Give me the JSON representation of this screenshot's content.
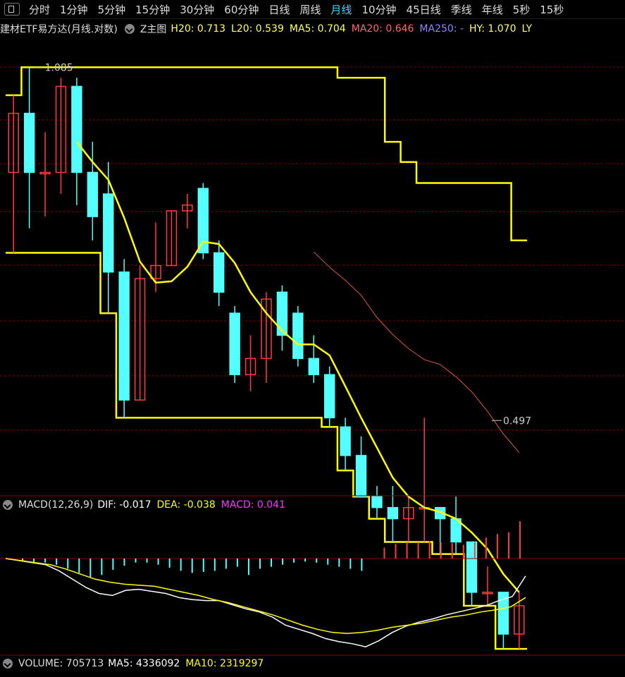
{
  "tabs": [
    "分时",
    "1分钟",
    "5分钟",
    "15分钟",
    "30分钟",
    "60分钟",
    "日线",
    "周线",
    "月线",
    "10分钟",
    "45日线",
    "季线",
    "年线",
    "5秒",
    "15秒"
  ],
  "active_tab": "月线",
  "main_info": {
    "title": "建材ETF易方达(月线.对数)",
    "indicator": "Z主图",
    "items": [
      {
        "text": "H20: 0.713",
        "color": "#ffff66"
      },
      {
        "text": "L20: 0.539",
        "color": "#ffff66"
      },
      {
        "text": "MA5: 0.704",
        "color": "#ffff66"
      },
      {
        "text": "MA20: 0.646",
        "color": "#ff6666"
      },
      {
        "text": "MA250: -",
        "color": "#8888ff"
      },
      {
        "text": "HY: 1.070",
        "color": "#ffff66"
      },
      {
        "text": "LY",
        "color": "#ffff66"
      }
    ]
  },
  "macd_info": {
    "title": "MACD(12,26,9)",
    "items": [
      {
        "text": "DIF: -0.017",
        "color": "#ffffff"
      },
      {
        "text": "DEA: -0.038",
        "color": "#ffff00"
      },
      {
        "text": "MACD: 0.041",
        "color": "#ff33ff"
      }
    ]
  },
  "volume_info": {
    "title": "VOLUME: 705713",
    "items": [
      {
        "text": "MA5: 4336092",
        "color": "#ffffff"
      },
      {
        "text": "MA10: 2319297",
        "color": "#ffff00"
      }
    ]
  },
  "colors": {
    "up": "#ff3b3b",
    "down": "#54ffff",
    "yellow": "#ffff00",
    "ma20": "#d9534f",
    "grid": "#8b0000",
    "dif": "#ffffff",
    "dea": "#ffff00"
  },
  "chart_data": [
    {
      "type": "candlestick",
      "scale": "log",
      "ylim": [
        0.45,
        1.15
      ],
      "annotations": [
        {
          "text": "1.085",
          "value": 1.085,
          "index": 1
        },
        {
          "text": "0.497",
          "value": 0.497,
          "index": 30
        }
      ],
      "candles": [
        {
          "o": 0.86,
          "h": 1.02,
          "l": 0.72,
          "c": 0.98
        },
        {
          "o": 0.98,
          "h": 1.085,
          "l": 0.76,
          "c": 0.86
        },
        {
          "o": 0.86,
          "h": 0.94,
          "l": 0.78,
          "c": 0.86
        },
        {
          "o": 0.86,
          "h": 1.06,
          "l": 0.82,
          "c": 1.04
        },
        {
          "o": 1.04,
          "h": 1.06,
          "l": 0.8,
          "c": 0.86
        },
        {
          "o": 0.86,
          "h": 0.92,
          "l": 0.74,
          "c": 0.78
        },
        {
          "o": 0.82,
          "h": 0.88,
          "l": 0.63,
          "c": 0.69
        },
        {
          "o": 0.69,
          "h": 0.71,
          "l": 0.5,
          "c": 0.52
        },
        {
          "o": 0.52,
          "h": 0.7,
          "l": 0.52,
          "c": 0.68
        },
        {
          "o": 0.68,
          "h": 0.77,
          "l": 0.66,
          "c": 0.7
        },
        {
          "o": 0.7,
          "h": 0.79,
          "l": 0.7,
          "c": 0.79
        },
        {
          "o": 0.79,
          "h": 0.82,
          "l": 0.76,
          "c": 0.8
        },
        {
          "o": 0.83,
          "h": 0.84,
          "l": 0.71,
          "c": 0.72
        },
        {
          "o": 0.72,
          "h": 0.74,
          "l": 0.64,
          "c": 0.66
        },
        {
          "o": 0.63,
          "h": 0.64,
          "l": 0.54,
          "c": 0.55
        },
        {
          "o": 0.55,
          "h": 0.6,
          "l": 0.53,
          "c": 0.57
        },
        {
          "o": 0.57,
          "h": 0.66,
          "l": 0.54,
          "c": 0.65
        },
        {
          "o": 0.66,
          "h": 0.67,
          "l": 0.58,
          "c": 0.6
        },
        {
          "o": 0.63,
          "h": 0.64,
          "l": 0.56,
          "c": 0.57
        },
        {
          "o": 0.57,
          "h": 0.6,
          "l": 0.54,
          "c": 0.55
        },
        {
          "o": 0.55,
          "h": 0.56,
          "l": 0.49,
          "c": 0.5
        },
        {
          "o": 0.49,
          "h": 0.5,
          "l": 0.445,
          "c": 0.46
        },
        {
          "o": 0.46,
          "h": 0.48,
          "l": 0.42,
          "c": 0.42
        },
        {
          "o": 0.42,
          "h": 0.43,
          "l": 0.4,
          "c": 0.41
        },
        {
          "o": 0.41,
          "h": 0.43,
          "l": 0.38,
          "c": 0.4
        },
        {
          "o": 0.4,
          "h": 0.42,
          "l": 0.38,
          "c": 0.41
        },
        {
          "o": 0.41,
          "h": 0.5,
          "l": 0.38,
          "c": 0.41
        },
        {
          "o": 0.41,
          "h": 0.41,
          "l": 0.37,
          "c": 0.4
        },
        {
          "o": 0.4,
          "h": 0.42,
          "l": 0.37,
          "c": 0.38
        },
        {
          "o": 0.38,
          "h": 0.38,
          "l": 0.33,
          "c": 0.34
        },
        {
          "o": 0.34,
          "h": 0.36,
          "l": 0.33,
          "c": 0.34
        },
        {
          "o": 0.34,
          "h": 0.34,
          "l": 0.3,
          "c": 0.31
        },
        {
          "o": 0.31,
          "h": 0.34,
          "l": 0.3,
          "c": 0.33
        }
      ]
    },
    {
      "type": "bar",
      "title": "MACD(12,26,9)",
      "series": [
        {
          "name": "MACD",
          "values": [
            0.0,
            -0.003,
            -0.004,
            -0.004,
            -0.006,
            -0.01,
            -0.014,
            -0.018,
            -0.016,
            -0.011,
            -0.007,
            -0.004,
            -0.004,
            -0.006,
            -0.009,
            -0.012,
            -0.014,
            -0.013,
            -0.012,
            -0.01,
            -0.008,
            -0.016,
            -0.01,
            -0.008,
            -0.006,
            -0.004,
            -0.003,
            -0.004,
            -0.006,
            -0.008,
            -0.01,
            -0.012,
            0.0,
            0.012,
            0.016,
            0.018,
            0.018,
            0.019,
            0.018,
            0.017,
            0.015,
            0.018,
            0.023,
            0.027,
            0.029,
            0.041
          ]
        },
        {
          "name": "DIF",
          "values": [
            0.0,
            -0.002,
            -0.004,
            -0.006,
            -0.012,
            -0.02,
            -0.028,
            -0.034,
            -0.036,
            -0.031,
            -0.03,
            -0.032,
            -0.034,
            -0.038,
            -0.04,
            -0.041,
            -0.041,
            -0.045,
            -0.049,
            -0.052,
            -0.057,
            -0.065,
            -0.069,
            -0.073,
            -0.078,
            -0.081,
            -0.083,
            -0.086,
            -0.08,
            -0.072,
            -0.066,
            -0.062,
            -0.059,
            -0.055,
            -0.052,
            -0.049,
            -0.046,
            -0.041,
            -0.037,
            -0.017
          ]
        },
        {
          "name": "DEA",
          "values": [
            0.0,
            -0.002,
            -0.004,
            -0.006,
            -0.01,
            -0.015,
            -0.02,
            -0.023,
            -0.025,
            -0.026,
            -0.027,
            -0.03,
            -0.033,
            -0.036,
            -0.04,
            -0.043,
            -0.047,
            -0.051,
            -0.055,
            -0.06,
            -0.065,
            -0.069,
            -0.072,
            -0.073,
            -0.072,
            -0.07,
            -0.067,
            -0.065,
            -0.063,
            -0.06,
            -0.057,
            -0.055,
            -0.052,
            -0.05,
            -0.047,
            -0.038
          ]
        }
      ]
    }
  ]
}
